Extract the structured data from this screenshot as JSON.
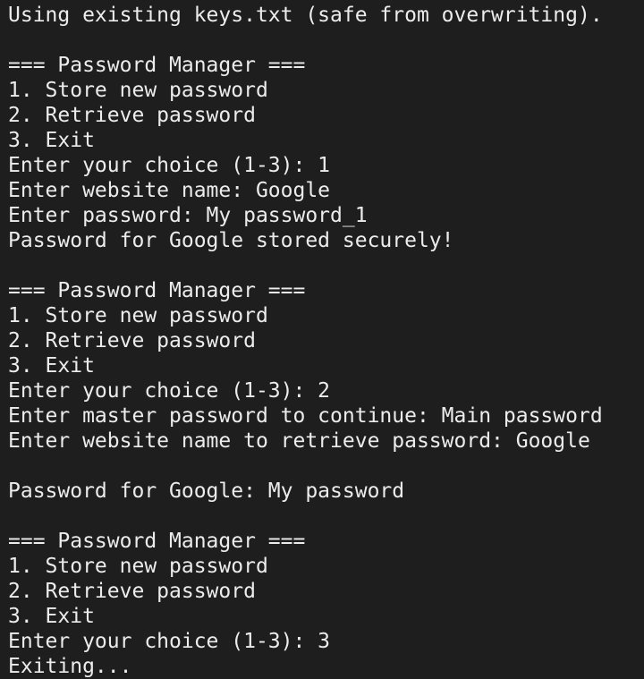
{
  "terminal": {
    "lines": [
      "Using existing keys.txt (safe from overwriting).",
      "",
      "=== Password Manager ===",
      "1. Store new password",
      "2. Retrieve password",
      "3. Exit",
      "Enter your choice (1-3): 1",
      "Enter website name: Google",
      "Enter password: My password_1",
      "Password for Google stored securely!",
      "",
      "=== Password Manager ===",
      "1. Store new password",
      "2. Retrieve password",
      "3. Exit",
      "Enter your choice (1-3): 2",
      "Enter master password to continue: Main password",
      "Enter website name to retrieve password: Google",
      "",
      "Password for Google: My password",
      "",
      "=== Password Manager ===",
      "1. Store new password",
      "2. Retrieve password",
      "3. Exit",
      "Enter your choice (1-3): 3",
      "Exiting..."
    ]
  },
  "colors": {
    "background": "#1e1e1e",
    "text": "#ececec"
  }
}
